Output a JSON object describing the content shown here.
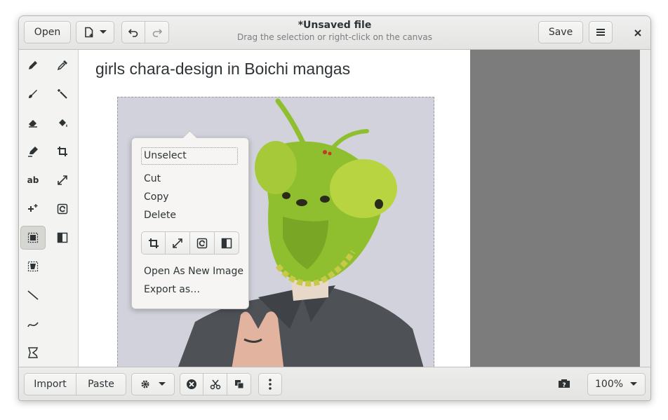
{
  "header": {
    "open_label": "Open",
    "title": "*Unsaved file",
    "subtitle": "Drag the selection or right-click on the canvas",
    "save_label": "Save"
  },
  "canvas": {
    "text": "girls chara-design in Boichi mangas"
  },
  "context_menu": {
    "unselect": "Unselect",
    "cut": "Cut",
    "copy": "Copy",
    "delete": "Delete",
    "open_as_new": "Open As New Image",
    "export_as": "Export as…"
  },
  "bottom": {
    "import_label": "Import",
    "paste_label": "Paste",
    "zoom_label": "100%"
  },
  "colors": {
    "mask_green": "#8fbf2e",
    "shirt": "#4e5257",
    "background": "#d2d2dc"
  },
  "icons": [
    "new-image-icon",
    "undo-icon",
    "redo-icon",
    "menu-icon",
    "close-icon",
    "pencil-icon",
    "color-picker-icon",
    "brush-icon",
    "magic-wand-icon",
    "eraser-icon",
    "paint-bucket-icon",
    "highlighter-icon",
    "crop-icon",
    "text-icon",
    "scale-icon",
    "sparkles-icon",
    "rotate-icon",
    "rect-select-icon",
    "filters-icon",
    "free-select-icon",
    "line-icon",
    "curve-icon",
    "shape-icon",
    "gear-icon",
    "unselect-icon",
    "scissors-icon",
    "duplicate-icon",
    "more-icon",
    "help-icon",
    "chevron-down-icon"
  ]
}
